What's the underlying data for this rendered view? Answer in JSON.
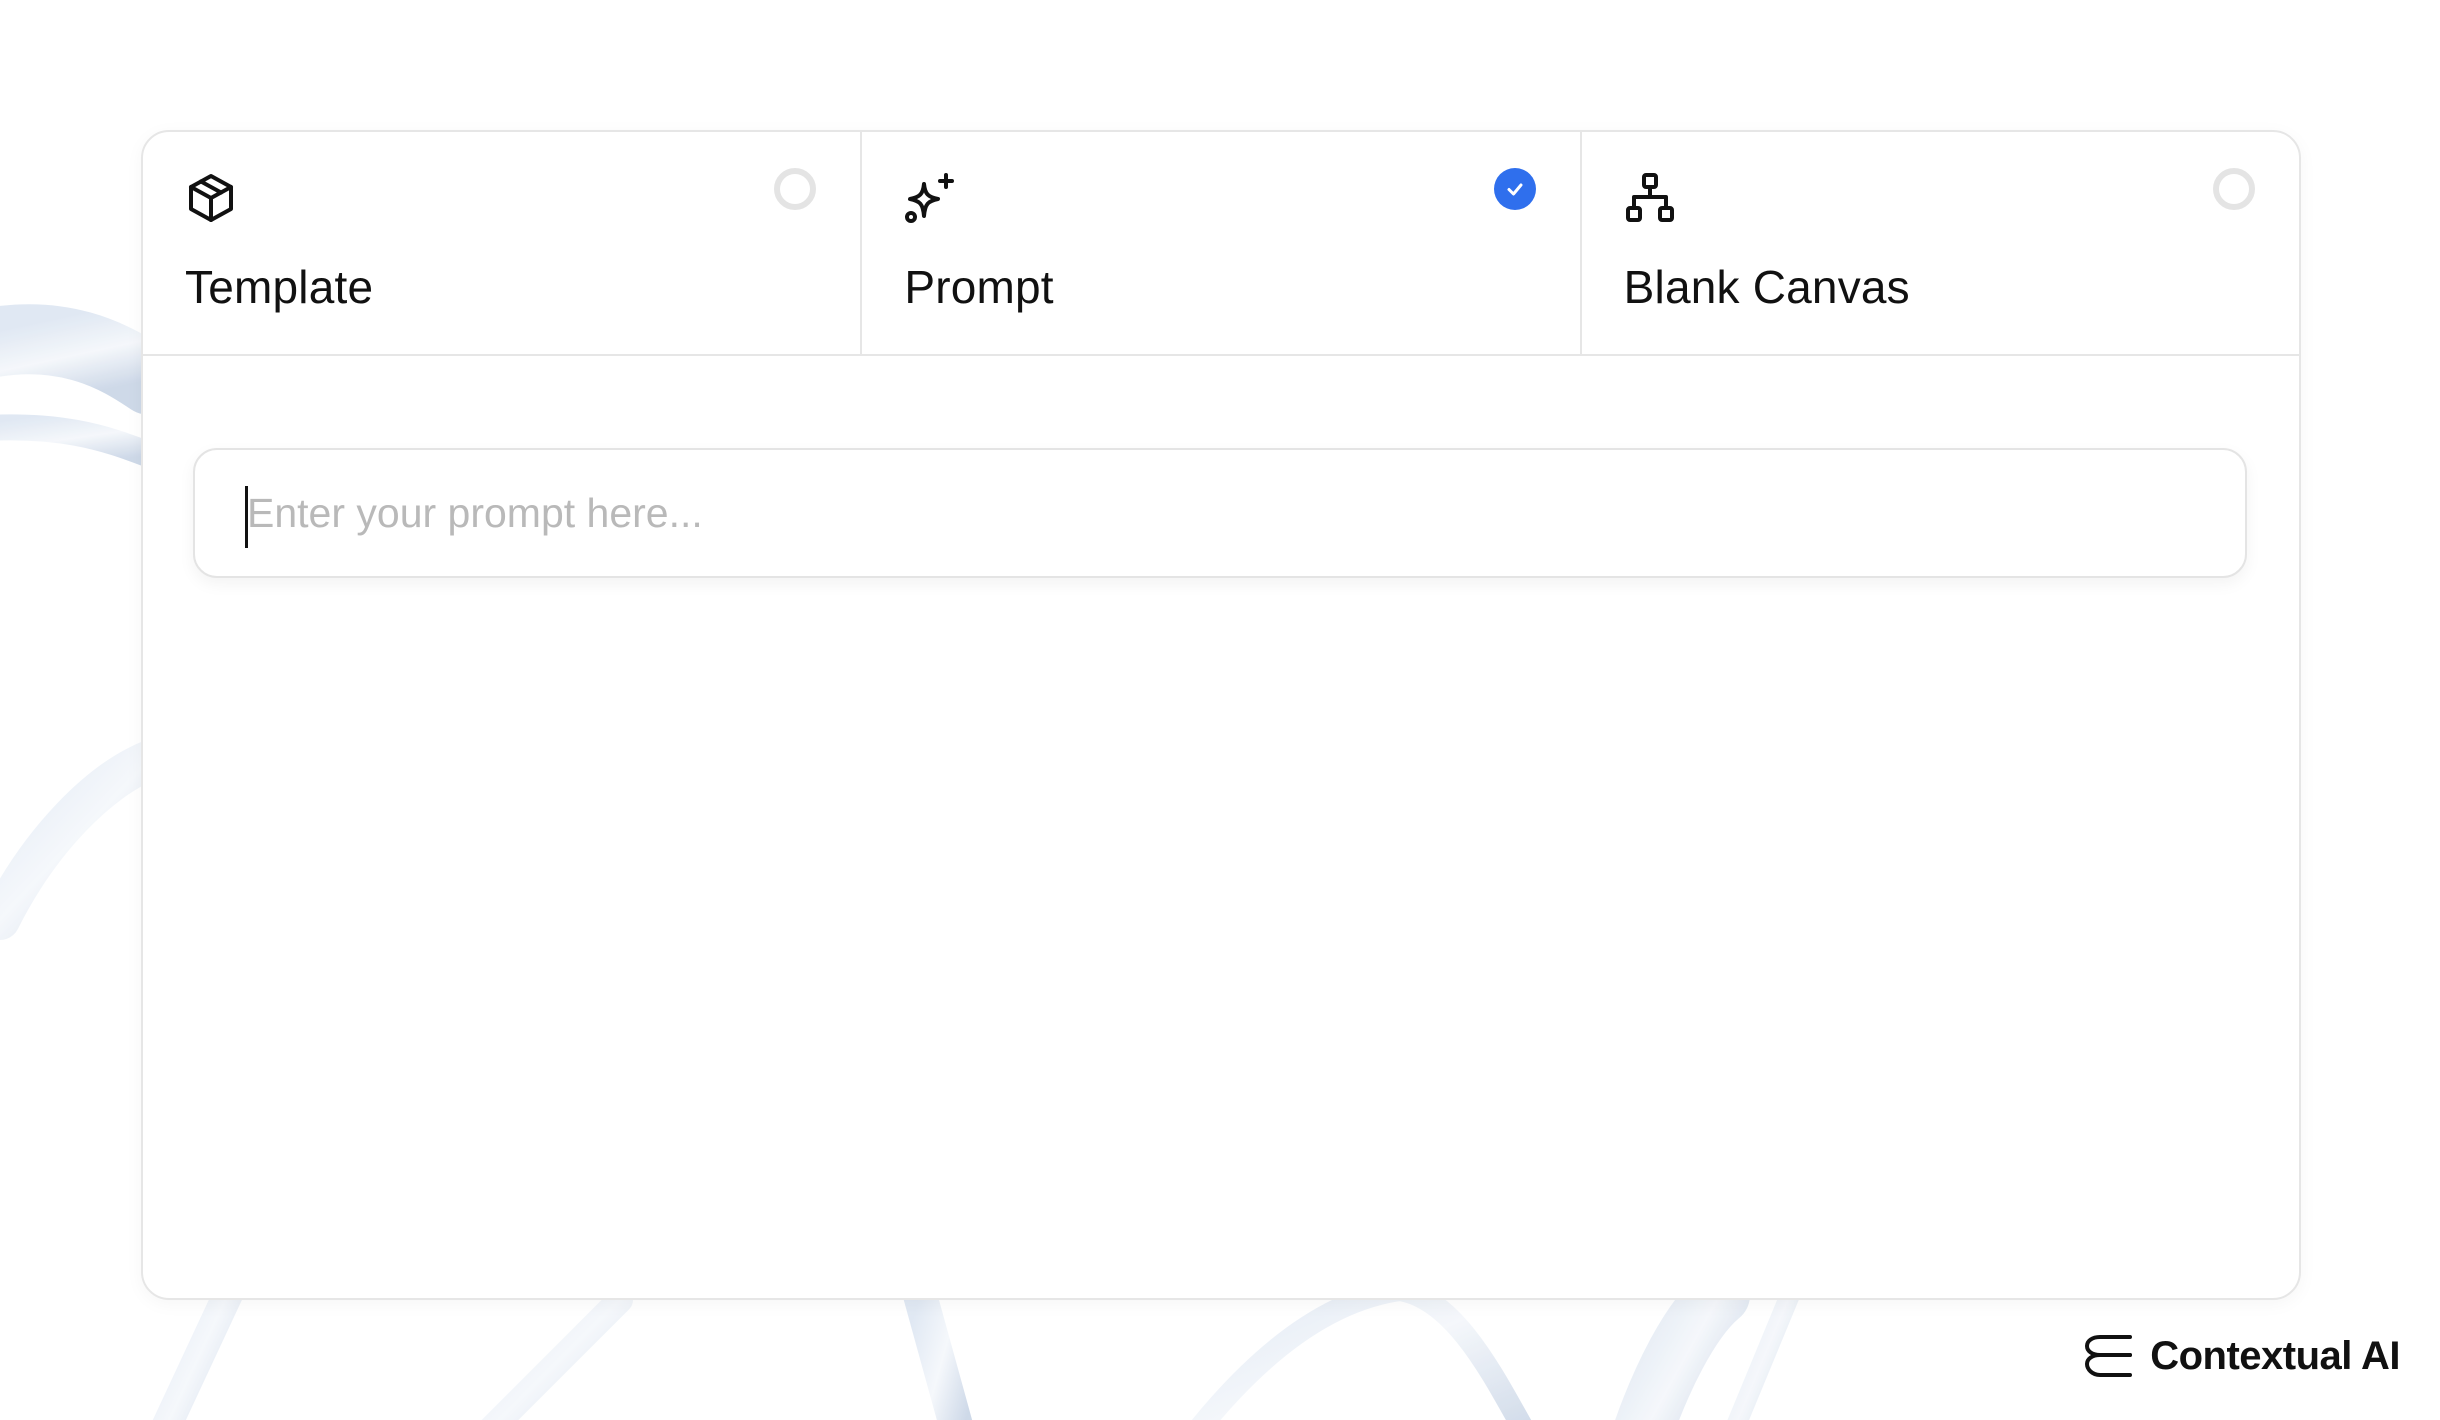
{
  "options": [
    {
      "label": "Template",
      "icon": "cube-icon",
      "selected": false
    },
    {
      "label": "Prompt",
      "icon": "sparkles-icon",
      "selected": true
    },
    {
      "label": "Blank Canvas",
      "icon": "hierarchy-icon",
      "selected": false
    }
  ],
  "prompt": {
    "value": "",
    "placeholder": "Enter your prompt here..."
  },
  "brand": {
    "name": "Contextual AI",
    "icon": "contextual-logo-icon"
  },
  "colors": {
    "accent": "#2f6fed",
    "border": "#e6e6e6",
    "placeholder": "#b9b9b9",
    "text": "#111111"
  }
}
